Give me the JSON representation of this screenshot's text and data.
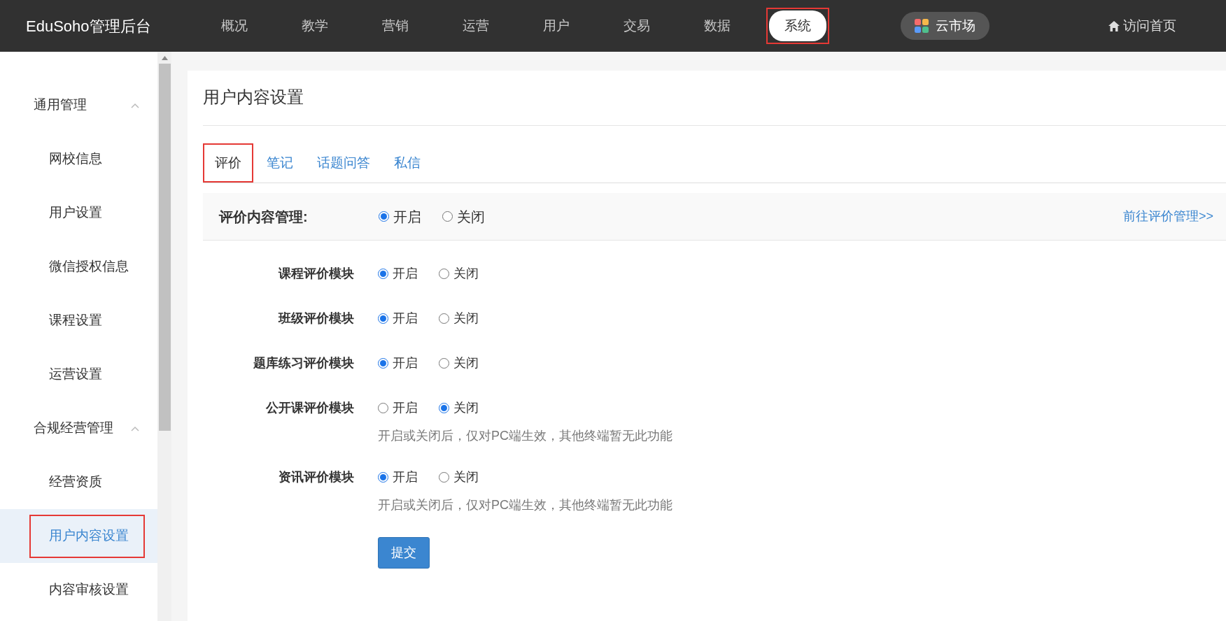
{
  "brand": "EduSoho管理后台",
  "nav": [
    {
      "label": "概况",
      "selected": false,
      "highlighted": false
    },
    {
      "label": "教学",
      "selected": false,
      "highlighted": false
    },
    {
      "label": "营销",
      "selected": false,
      "highlighted": false
    },
    {
      "label": "运营",
      "selected": false,
      "highlighted": false
    },
    {
      "label": "用户",
      "selected": false,
      "highlighted": false
    },
    {
      "label": "交易",
      "selected": false,
      "highlighted": false
    },
    {
      "label": "数据",
      "selected": false,
      "highlighted": false
    },
    {
      "label": "系统",
      "selected": true,
      "highlighted": true
    }
  ],
  "market_button": "云市场",
  "home_link": "访问首页",
  "sidebar": [
    {
      "label": "通用管理",
      "expanded": true,
      "children": [
        {
          "label": "网校信息",
          "selected": false,
          "highlighted": false
        },
        {
          "label": "用户设置",
          "selected": false,
          "highlighted": false
        },
        {
          "label": "微信授权信息",
          "selected": false,
          "highlighted": false
        },
        {
          "label": "课程设置",
          "selected": false,
          "highlighted": false
        },
        {
          "label": "运营设置",
          "selected": false,
          "highlighted": false
        }
      ]
    },
    {
      "label": "合规经营管理",
      "expanded": true,
      "children": [
        {
          "label": "经营资质",
          "selected": false,
          "highlighted": false
        },
        {
          "label": "用户内容设置",
          "selected": true,
          "highlighted": true
        },
        {
          "label": "内容审核设置",
          "selected": false,
          "highlighted": false
        }
      ]
    }
  ],
  "page_title": "用户内容设置",
  "tabs": [
    {
      "label": "评价",
      "selected": true,
      "highlighted": true
    },
    {
      "label": "笔记",
      "selected": false,
      "highlighted": false
    },
    {
      "label": "话题问答",
      "selected": false,
      "highlighted": false
    },
    {
      "label": "私信",
      "selected": false,
      "highlighted": false
    }
  ],
  "section": {
    "label": "评价内容管理:",
    "options": [
      {
        "label": "开启",
        "selected": true
      },
      {
        "label": "关闭",
        "selected": false
      }
    ],
    "link": "前往评价管理>>"
  },
  "settings": [
    {
      "label": "课程评价模块",
      "options": [
        {
          "label": "开启",
          "selected": true
        },
        {
          "label": "关闭",
          "selected": false
        }
      ]
    },
    {
      "label": "班级评价模块",
      "options": [
        {
          "label": "开启",
          "selected": true
        },
        {
          "label": "关闭",
          "selected": false
        }
      ]
    },
    {
      "label": "题库练习评价模块",
      "options": [
        {
          "label": "开启",
          "selected": true
        },
        {
          "label": "关闭",
          "selected": false
        }
      ]
    },
    {
      "label": "公开课评价模块",
      "options": [
        {
          "label": "开启",
          "selected": false
        },
        {
          "label": "关闭",
          "selected": true
        }
      ],
      "help": "开启或关闭后，仅对PC端生效，其他终端暂无此功能"
    },
    {
      "label": "资讯评价模块",
      "options": [
        {
          "label": "开启",
          "selected": true
        },
        {
          "label": "关闭",
          "selected": false
        }
      ],
      "help": "开启或关闭后，仅对PC端生效，其他终端暂无此功能"
    }
  ],
  "submit": "提交"
}
